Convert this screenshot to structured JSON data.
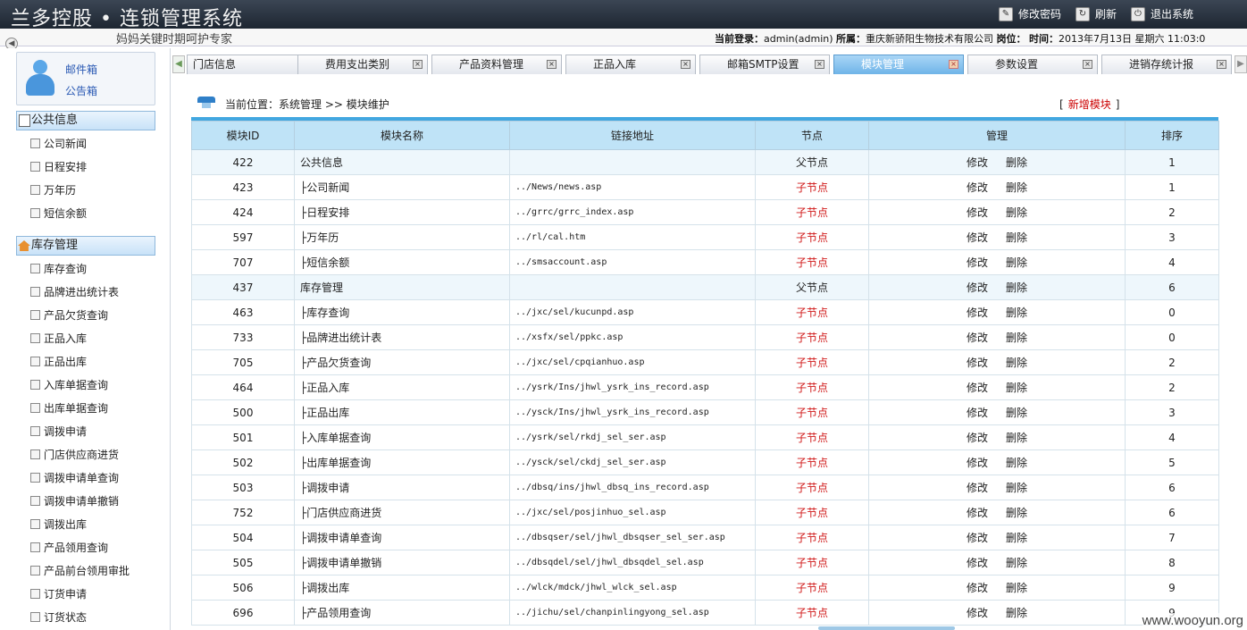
{
  "app": {
    "title": "兰多控股 • 连锁管理系统",
    "slogan": "妈妈关键时期呵护专家"
  },
  "toplinks": [
    {
      "label": "修改密码",
      "icon": "edit-icon"
    },
    {
      "label": "刷新",
      "icon": "refresh-icon"
    },
    {
      "label": "退出系统",
      "icon": "logout-icon"
    }
  ],
  "userinfo": {
    "login_label": "当前登录：",
    "login_value": "admin(admin)",
    "org_label": "所属：",
    "org_value": "重庆新骄阳生物技术有限公司",
    "post_label": "岗位：",
    "time_label": "时间：",
    "time_value": "2013年7月13日  星期六  11:03:0"
  },
  "mailbox": {
    "mail": "邮件箱",
    "notice": "公告箱"
  },
  "sidebar": {
    "sections": [
      {
        "title": "公共信息",
        "icon": "document-icon",
        "items": [
          "公司新闻",
          "日程安排",
          "万年历",
          "短信余额"
        ]
      },
      {
        "title": "库存管理",
        "icon": "home-icon",
        "items": [
          "库存查询",
          "品牌进出统计表",
          "产品欠货查询",
          "正品入库",
          "正品出库",
          "入库单据查询",
          "出库单据查询",
          "调拨申请",
          "门店供应商进货",
          "调拨申请单查询",
          "调拨申请单撤销",
          "调拨出库",
          "产品领用查询",
          "产品前台领用审批",
          "订货申请",
          "订货状态"
        ]
      }
    ]
  },
  "tabs": [
    {
      "label": "门店信息",
      "active": false
    },
    {
      "label": "费用支出类别",
      "active": false
    },
    {
      "label": "产品资料管理",
      "active": false
    },
    {
      "label": "正品入库",
      "active": false
    },
    {
      "label": "邮箱SMTP设置",
      "active": false
    },
    {
      "label": "模块管理",
      "active": true
    },
    {
      "label": "参数设置",
      "active": false
    },
    {
      "label": "进销存统计报",
      "active": false
    }
  ],
  "breadcrumb": {
    "text": "当前位置：系统管理 >> 模块维护",
    "add_label": "新增模块",
    "bracket_left": "[",
    "bracket_right": "]"
  },
  "table": {
    "headers": [
      "模块ID",
      "模块名称",
      "链接地址",
      "节点",
      "管理",
      "排序"
    ],
    "edit_label": "修改",
    "delete_label": "删除",
    "rows": [
      {
        "id": "422",
        "name": "公共信息",
        "url": "",
        "node": "父节点",
        "parent": true,
        "order": "1"
      },
      {
        "id": "423",
        "name": "├公司新闻",
        "url": "../News/news.asp",
        "node": "子节点",
        "parent": false,
        "order": "1"
      },
      {
        "id": "424",
        "name": "├日程安排",
        "url": "../grrc/grrc_index.asp",
        "node": "子节点",
        "parent": false,
        "order": "2"
      },
      {
        "id": "597",
        "name": "├万年历",
        "url": "../rl/cal.htm",
        "node": "子节点",
        "parent": false,
        "order": "3"
      },
      {
        "id": "707",
        "name": "├短信余额",
        "url": "../smsaccount.asp",
        "node": "子节点",
        "parent": false,
        "order": "4"
      },
      {
        "id": "437",
        "name": "库存管理",
        "url": "",
        "node": "父节点",
        "parent": true,
        "order": "6"
      },
      {
        "id": "463",
        "name": "├库存查询",
        "url": "../jxc/sel/kucunpd.asp",
        "node": "子节点",
        "parent": false,
        "order": "0"
      },
      {
        "id": "733",
        "name": "├品牌进出统计表",
        "url": "../xsfx/sel/ppkc.asp",
        "node": "子节点",
        "parent": false,
        "order": "0"
      },
      {
        "id": "705",
        "name": "├产品欠货查询",
        "url": "../jxc/sel/cpqianhuo.asp",
        "node": "子节点",
        "parent": false,
        "order": "2"
      },
      {
        "id": "464",
        "name": "├正品入库",
        "url": "../ysrk/Ins/jhwl_ysrk_ins_record.asp",
        "node": "子节点",
        "parent": false,
        "order": "2"
      },
      {
        "id": "500",
        "name": "├正品出库",
        "url": "../ysck/Ins/jhwl_ysrk_ins_record.asp",
        "node": "子节点",
        "parent": false,
        "order": "3"
      },
      {
        "id": "501",
        "name": "├入库单据查询",
        "url": "../ysrk/sel/rkdj_sel_ser.asp",
        "node": "子节点",
        "parent": false,
        "order": "4"
      },
      {
        "id": "502",
        "name": "├出库单据查询",
        "url": "../ysck/sel/ckdj_sel_ser.asp",
        "node": "子节点",
        "parent": false,
        "order": "5"
      },
      {
        "id": "503",
        "name": "├调拨申请",
        "url": "../dbsq/ins/jhwl_dbsq_ins_record.asp",
        "node": "子节点",
        "parent": false,
        "order": "6"
      },
      {
        "id": "752",
        "name": "├门店供应商进货",
        "url": "../jxc/sel/posjinhuo_sel.asp",
        "node": "子节点",
        "parent": false,
        "order": "6"
      },
      {
        "id": "504",
        "name": "├调拨申请单查询",
        "url": "../dbsqser/sel/jhwl_dbsqser_sel_ser.asp",
        "node": "子节点",
        "parent": false,
        "order": "7"
      },
      {
        "id": "505",
        "name": "├调拨申请单撤销",
        "url": "../dbsqdel/sel/jhwl_dbsqdel_sel.asp",
        "node": "子节点",
        "parent": false,
        "order": "8"
      },
      {
        "id": "506",
        "name": "├调拨出库",
        "url": "../wlck/mdck/jhwl_wlck_sel.asp",
        "node": "子节点",
        "parent": false,
        "order": "9"
      },
      {
        "id": "696",
        "name": "├产品领用查询",
        "url": "../jichu/sel/chanpinlingyong_sel.asp",
        "node": "子节点",
        "parent": false,
        "order": "9"
      }
    ]
  },
  "watermark": "www.wooyun.org"
}
